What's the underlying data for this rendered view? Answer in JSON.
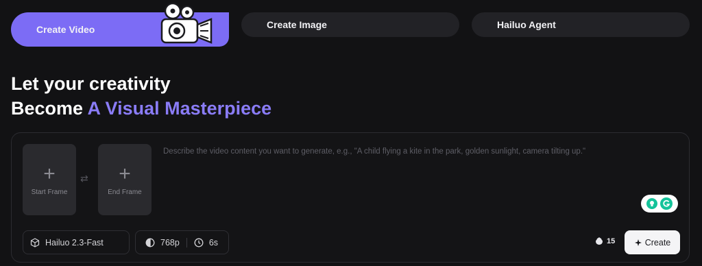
{
  "tabs": [
    {
      "label": "Create Video",
      "active": true
    },
    {
      "label": "Create Image",
      "active": false
    },
    {
      "label": "Hailuo Agent",
      "active": false
    }
  ],
  "headline": {
    "line1": "Let your creativity",
    "line2_prefix": "Become ",
    "line2_accent": "A Visual Masterpiece"
  },
  "frames": {
    "start_label": "Start Frame",
    "end_label": "End Frame"
  },
  "prompt": {
    "placeholder": "Describe the video content you want to generate, e.g., \"A child flying a kite in the park, golden sunlight, camera tilting up.\"",
    "value": ""
  },
  "settings": {
    "model": "Hailuo 2.3-Fast",
    "resolution": "768p",
    "duration": "6s"
  },
  "credits": "15",
  "create_label": "Create",
  "colors": {
    "accent": "#7c6cf5",
    "accent_text": "#8a7cf7",
    "background": "#121214",
    "grammarly": "#15c39a"
  },
  "icons": {
    "camera": "film-camera-icon",
    "model": "cube-icon",
    "resolution": "aperture-icon",
    "duration": "clock-icon",
    "credits": "credit-coin-icon",
    "create": "sparkle-icon",
    "swap": "swap-arrows-icon"
  }
}
